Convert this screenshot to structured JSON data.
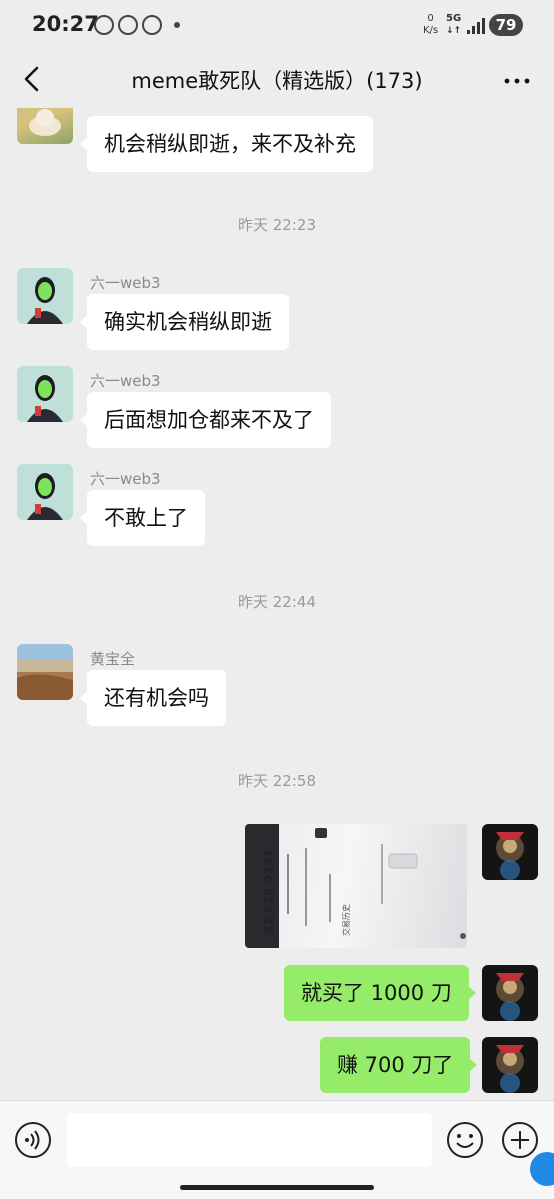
{
  "status_bar": {
    "time": "20:27",
    "net_speed_value": "0",
    "net_speed_unit": "K/s",
    "network": "5G",
    "battery": "79"
  },
  "header": {
    "title": "meme敢死队（精选版）(173)"
  },
  "messages": [
    {
      "type": "text",
      "side": "left",
      "text": "机会稍纵即逝，来不及补充"
    },
    {
      "type": "time",
      "text": "昨天 22:23"
    },
    {
      "type": "text",
      "side": "left",
      "sender": "六一web3",
      "text": "确实机会稍纵即逝"
    },
    {
      "type": "text",
      "side": "left",
      "sender": "六一web3",
      "text": "后面想加仓都来不及了"
    },
    {
      "type": "text",
      "side": "left",
      "sender": "六一web3",
      "text": "不敢上了"
    },
    {
      "type": "time",
      "text": "昨天 22:44"
    },
    {
      "type": "text",
      "side": "left",
      "sender": "黄宝全",
      "text": "还有机会吗"
    },
    {
      "type": "time",
      "text": "昨天 22:58"
    },
    {
      "type": "image",
      "side": "right",
      "image_text": [
        "32,618.9297",
        "交易历史"
      ]
    },
    {
      "type": "text",
      "side": "right",
      "text": "就买了 1000 刀"
    },
    {
      "type": "text",
      "side": "right",
      "text": "赚 700 刀了"
    }
  ],
  "input_bar": {
    "placeholder": "",
    "voice_icon": "voice-icon",
    "emoji_icon": "emoji-icon",
    "plus_icon": "plus-icon"
  },
  "colors": {
    "background": "#ededed",
    "bubble_self": "#95ec69",
    "bubble_other": "#ffffff",
    "timestamp": "#9a9a9a"
  }
}
